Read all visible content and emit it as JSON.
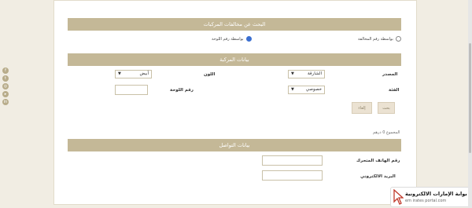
{
  "social_icons": [
    "facebook-icon",
    "twitter-icon",
    "instagram-icon",
    "youtube-icon",
    "linkedin-icon"
  ],
  "search_section": {
    "title": "البحث عن مخالفات المركبات",
    "option_plate": "بواسطة رقم اللوحة",
    "option_fine": "بواسطة رقم المخالفة",
    "selected": "option_plate"
  },
  "vehicle_section": {
    "title": "بيانات المركبة",
    "source_label": "المصدر",
    "source_value": "الشارقة",
    "color_label": "اللون",
    "color_value": "أبيض",
    "category_label": "الفئة",
    "category_value": "خصوصي",
    "plate_label": "رقم اللوحة",
    "plate_value": "",
    "search_button": "بحث",
    "reset_button": "إلغاء"
  },
  "total_text": "المجموع 0 درهم",
  "contact_section": {
    "title": "بيانات التواصل",
    "mobile_label": "رقم الهاتف المتحرك",
    "mobile_value": "",
    "email_label": "البريد الالكتروني",
    "email_value": ""
  },
  "brand": {
    "name": "بوابة الإمارات الالكترونية",
    "url": "em irates portal.com"
  },
  "colors": {
    "accent": "#c4b897",
    "background": "#f1ede3",
    "selected_radio": "#3b6fd0"
  }
}
